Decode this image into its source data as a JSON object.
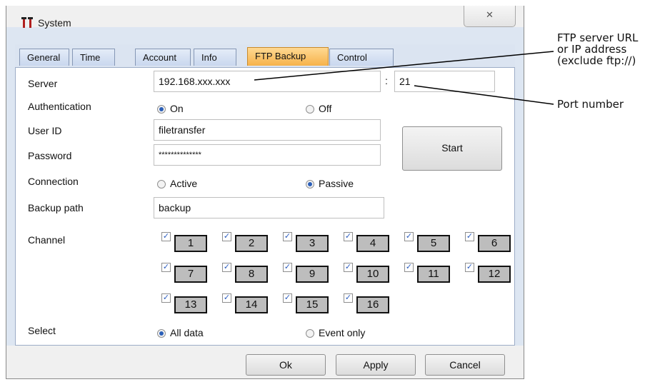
{
  "window": {
    "title": "System",
    "close_glyph": "✕",
    "app_icon": "system-app-icon"
  },
  "tabs": [
    {
      "label": "General",
      "active": false
    },
    {
      "label": "Time",
      "active": false
    },
    {
      "label": "Account",
      "active": false
    },
    {
      "label": "Info",
      "active": false
    },
    {
      "label": "FTP Backup",
      "active": true
    },
    {
      "label": "Control",
      "active": false
    }
  ],
  "form": {
    "server_label": "Server",
    "server_value": "192.168.xxx.xxx",
    "port_separator": ":",
    "port_value": "21",
    "auth_label": "Authentication",
    "auth_on": "On",
    "auth_off": "Off",
    "auth_selected": "On",
    "userid_label": "User ID",
    "userid_value": "filetransfer",
    "password_label": "Password",
    "password_value": "**************",
    "start_label": "Start",
    "connection_label": "Connection",
    "conn_active": "Active",
    "conn_passive": "Passive",
    "conn_selected": "Passive",
    "backup_label": "Backup path",
    "backup_value": "backup",
    "channel_label": "Channel",
    "channels": [
      "1",
      "2",
      "3",
      "4",
      "5",
      "6",
      "7",
      "8",
      "9",
      "10",
      "11",
      "12",
      "13",
      "14",
      "15",
      "16"
    ],
    "select_label": "Select",
    "select_all": "All data",
    "select_event": "Event only",
    "select_selected": "All data"
  },
  "buttons": {
    "ok": "Ok",
    "apply": "Apply",
    "cancel": "Cancel"
  },
  "callouts": {
    "server_line1": "FTP server URL",
    "server_line2": "or IP address",
    "server_line3": "(exclude ftp://)",
    "port": "Port number"
  },
  "colors": {
    "active_tab": "#f6b24a",
    "radio_dot": "#2b5fb8",
    "channel_box": "#bdbdbd"
  }
}
